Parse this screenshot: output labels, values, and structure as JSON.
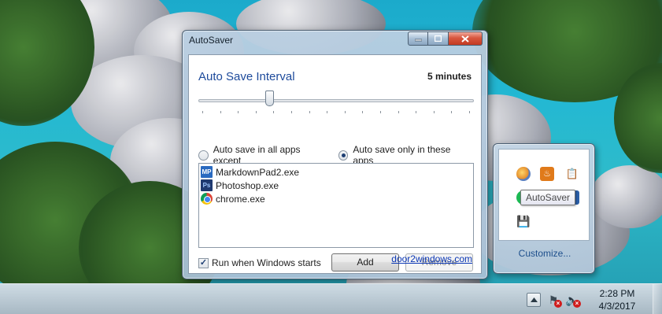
{
  "window": {
    "title": "AutoSaver",
    "heading": "Auto Save Interval",
    "interval_value": "5 minutes",
    "slider_level": 0.25,
    "slider_ticks": 16,
    "radio_all": "Auto save in all apps except",
    "radio_only": "Auto save only in these apps",
    "selected_mode": "only",
    "apps": [
      {
        "name": "MarkdownPad2.exe",
        "icon": "markdownpad-icon",
        "badge": "MP"
      },
      {
        "name": "Photoshop.exe",
        "icon": "photoshop-icon",
        "badge": "Ps"
      },
      {
        "name": "chrome.exe",
        "icon": "chrome-icon",
        "badge": ""
      }
    ],
    "run_on_startup_label": "Run when Windows starts",
    "run_on_startup_checked": true,
    "add_label": "Add",
    "remove_label": "Remove",
    "remove_enabled": false,
    "link_text": "door2windows.com",
    "accent": "#1d4a9b"
  },
  "flyout": {
    "customize_label": "Customize...",
    "tooltip": "AutoSaver",
    "icons": [
      "colorpicker-icon",
      "java-icon",
      "clipboard-icon",
      "spotify-icon",
      "chrome-tray-icon",
      "app-tray-icon",
      "floppy-disk-icon"
    ]
  },
  "taskbar": {
    "time": "2:28 PM",
    "date": "4/3/2017",
    "show_hidden_icon": "arrow-up-icon",
    "tray_icons": [
      "action-center-flag-icon",
      "volume-muted-icon"
    ]
  }
}
